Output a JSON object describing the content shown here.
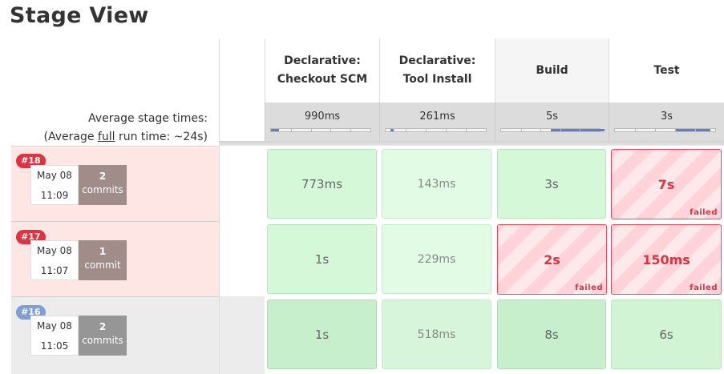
{
  "page": {
    "title": "Stage View"
  },
  "summary": {
    "avg_stage_times_label": "Average stage times:",
    "avg_run_prefix": "(Average ",
    "avg_run_full": "full",
    "avg_run_suffix": " run time: ~24s)"
  },
  "stages": [
    {
      "line1": "Declarative:",
      "line2": "Checkout SCM",
      "avg": "990ms",
      "avg_bar_fraction": 0.08
    },
    {
      "line1": "Declarative:",
      "line2": "Tool Install",
      "avg": "261ms",
      "avg_bar_fraction": 0.03
    },
    {
      "line1": "Build",
      "line2": "",
      "avg": "5s",
      "avg_bar_fraction": 0.55
    },
    {
      "line1": "Test",
      "line2": "",
      "avg": "3s",
      "avg_bar_fraction": 0.35
    }
  ],
  "builds": [
    {
      "number": "#18",
      "date": "May 08",
      "time": "11:09",
      "commits_count": "2",
      "commits_label": "commits",
      "status": "failed",
      "cells": [
        {
          "value": "773ms",
          "status": "success"
        },
        {
          "value": "143ms",
          "status": "success"
        },
        {
          "value": "3s",
          "status": "success"
        },
        {
          "value": "7s",
          "status": "failed",
          "tag": "failed"
        }
      ]
    },
    {
      "number": "#17",
      "date": "May 08",
      "time": "11:07",
      "commits_count": "1",
      "commits_label": "commit",
      "status": "failed",
      "cells": [
        {
          "value": "1s",
          "status": "success"
        },
        {
          "value": "229ms",
          "status": "success"
        },
        {
          "value": "2s",
          "status": "failed",
          "tag": "failed"
        },
        {
          "value": "150ms",
          "status": "failed",
          "tag": "failed"
        }
      ]
    },
    {
      "number": "#16",
      "date": "May 08",
      "time": "11:05",
      "commits_count": "2",
      "commits_label": "commits",
      "status": "success",
      "cells": [
        {
          "value": "1s",
          "status": "success"
        },
        {
          "value": "518ms",
          "status": "success"
        },
        {
          "value": "8s",
          "status": "success"
        },
        {
          "value": "6s",
          "status": "success"
        }
      ]
    }
  ],
  "colors": {
    "fail_red": "#e0333e",
    "success_green": "#d4f8d8",
    "bar_blue": "#5b7fd6"
  }
}
